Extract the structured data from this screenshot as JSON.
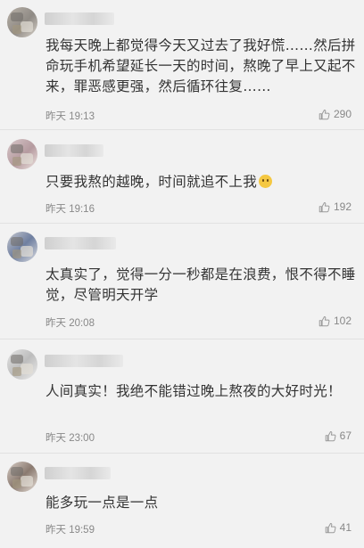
{
  "comments": [
    {
      "text": "我每天晚上都觉得今天又过去了我好慌……然后拼命玩手机希望延长一天的时间，熬晚了早上又起不来，罪恶感更强，然后循环往复……",
      "time": "昨天 19:13",
      "likes": "290"
    },
    {
      "text": "只要我熬的越晚，时间就追不上我",
      "emoji": "grinning-face-emoji",
      "time": "昨天 19:16",
      "likes": "192"
    },
    {
      "text": "太真实了，觉得一分一秒都是在浪费，恨不得不睡觉，尽管明天开学",
      "time": "昨天 20:08",
      "likes": "102"
    },
    {
      "text": "人间真实！我绝不能错过晚上熬夜的大好时光！",
      "time": "昨天 23:00",
      "likes": "67"
    },
    {
      "text": "能多玩一点是一点",
      "time": "昨天 19:59",
      "likes": "41"
    }
  ],
  "icons": {
    "like": "thumbs-up-icon"
  },
  "colors": {
    "background": "#f2f2f2",
    "text": "#333333",
    "meta": "#888888"
  }
}
